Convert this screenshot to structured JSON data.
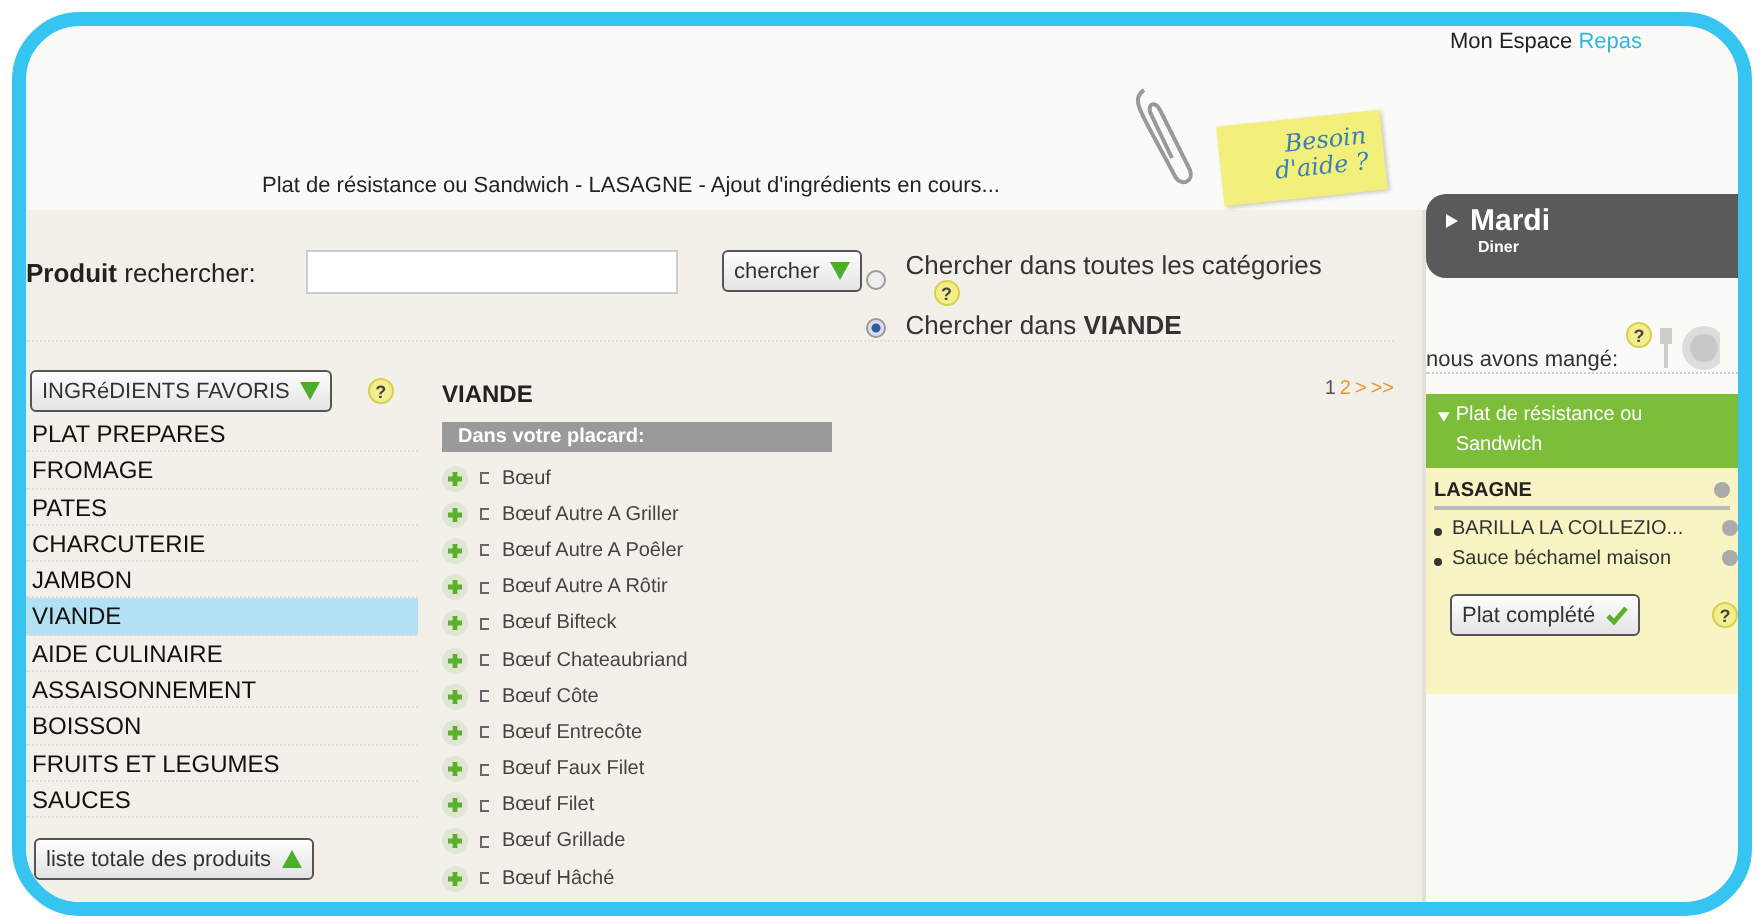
{
  "header": {
    "title": "Plat de résistance ou Sandwich - LASAGNE - Ajout d'ingrédients en cours...",
    "help_note": "Besoin d'aide ?",
    "brand_1": "Mon Espace",
    "brand_2": "Repas"
  },
  "search": {
    "label": "**Produit** rechercher:",
    "button": "chercher",
    "scopes": [
      {
        "label": "Chercher dans toutes les catégories",
        "selected": false,
        "help": "?"
      },
      {
        "label": "Chercher dans **VIANDE**",
        "selected": true
      }
    ]
  },
  "favorites_button": "INGRéDIENTS FAVORIS",
  "favorites_help": "?",
  "categories": [
    {
      "label": "PLAT PREPARES",
      "selected": false
    },
    {
      "label": "FROMAGE",
      "selected": false
    },
    {
      "label": "PATES",
      "selected": false
    },
    {
      "label": "CHARCUTERIE",
      "selected": false
    },
    {
      "label": "JAMBON",
      "selected": false
    },
    {
      "label": "VIANDE",
      "selected": true
    },
    {
      "label": "AIDE CULINAIRE",
      "selected": false
    },
    {
      "label": "ASSAISONNEMENT",
      "selected": false
    },
    {
      "label": "BOISSON",
      "selected": false
    },
    {
      "label": "FRUITS ET LEGUMES",
      "selected": false
    },
    {
      "label": "SAUCES",
      "selected": false
    }
  ],
  "all_products_button": "liste totale des produits",
  "products": {
    "title": "VIANDE",
    "section": "Dans votre placard:",
    "pages": [
      {
        "label": "1",
        "selected": true
      },
      {
        "label": "2",
        "selected": false
      }
    ],
    "next": ">",
    "last": ">>",
    "items": [
      "Bœuf",
      "Bœuf Autre A Griller",
      "Bœuf Autre A Poêler",
      "Bœuf Autre A Rôtir",
      "Bœuf Bifteck",
      "Bœuf Chateaubriand",
      "Bœuf Côte",
      "Bœuf Entrecôte",
      "Bœuf Faux Filet",
      "Bœuf Filet",
      "Bœuf Grillade",
      "Bœuf Hâché"
    ]
  },
  "day": {
    "name": "Mardi",
    "meal": "Diner",
    "eaten_label": "nous avons mangé:",
    "help": "?"
  },
  "dish": {
    "category": "Plat de résistance ou Sandwich",
    "name": "LASAGNE",
    "ingredients": [
      "BARILLA LA COLLEZIO...",
      "Sauce béchamel maison"
    ],
    "done_button": "Plat complété",
    "help": "?"
  }
}
